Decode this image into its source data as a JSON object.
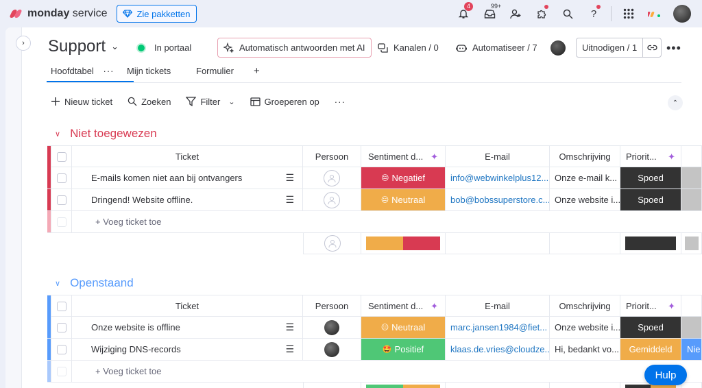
{
  "topbar": {
    "brand_bold": "monday",
    "brand_rest": " service",
    "packages_label": "Zie pakketten",
    "notifications_count": "4",
    "inbox_count": "99+"
  },
  "header": {
    "board_title": "Support",
    "portal_label": "In portaal",
    "ai_label": "Automatisch antwoorden met AI",
    "channels_label": "Kanalen / 0",
    "automate_label": "Automatiseer / 7",
    "invite_label": "Uitnodigen / 1"
  },
  "tabs": [
    {
      "label": "Hoofdtabel"
    },
    {
      "label": "Mijn tickets"
    },
    {
      "label": "Formulier"
    }
  ],
  "toolbar": {
    "new_ticket": "Nieuw ticket",
    "search": "Zoeken",
    "filter": "Filter",
    "group_by": "Groeperen op"
  },
  "columns": {
    "ticket": "Ticket",
    "person": "Persoon",
    "sentiment": "Sentiment d...",
    "email": "E-mail",
    "description": "Omschrijving",
    "priority": "Priorit..."
  },
  "add_ticket_label": "+ Voeg ticket toe",
  "colors": {
    "negative": "#d83a52",
    "neutral": "#f0ac49",
    "positive": "#4fc776",
    "urgent": "#333333",
    "medium": "#f0ac49",
    "group1": "#d83a52",
    "group2": "#579bfc"
  },
  "groups": [
    {
      "title": "Niet toegewezen",
      "rows": [
        {
          "ticket": "E-mails komen niet aan bij ontvangers",
          "sentiment": "Negatief",
          "emoji": "😔",
          "email": "info@webwinkelplus12...",
          "description": "Onze e-mail k...",
          "priority": "Spoed"
        },
        {
          "ticket": "Dringend! Website offline.",
          "sentiment": "Neutraal",
          "emoji": "😐",
          "email": "bob@bobssuperstore.c...",
          "description": "Onze website i...",
          "priority": "Spoed"
        }
      ]
    },
    {
      "title": "Openstaand",
      "rows": [
        {
          "ticket": "Onze website is offline",
          "sentiment": "Neutraal",
          "emoji": "😐",
          "email": "marc.jansen1984@fiet...",
          "description": "Onze website i...",
          "priority": "Spoed"
        },
        {
          "ticket": "Wijziging DNS-records",
          "sentiment": "Positief",
          "emoji": "🤩",
          "email": "klaas.de.vries@cloudze...",
          "description": "Hi, bedankt vo...",
          "priority": "Gemiddeld",
          "extra": "Nie"
        }
      ]
    }
  ],
  "help_label": "Hulp"
}
